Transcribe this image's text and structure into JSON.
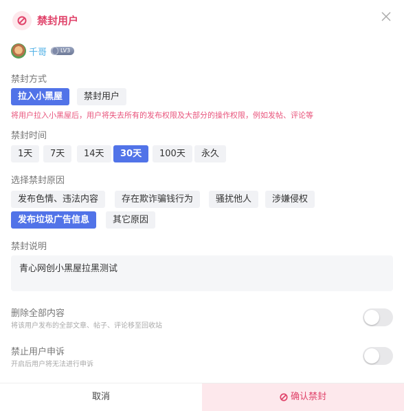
{
  "header": {
    "title": "禁封用户",
    "ban_icon": "ban-icon",
    "close_icon": "close-icon"
  },
  "user": {
    "name": "千哥",
    "level_badge": "LV3"
  },
  "ban_method": {
    "label": "禁封方式",
    "options": [
      "拉入小黑屋",
      "禁封用户"
    ],
    "selected": "拉入小黑屋",
    "hint": "将用户拉入小黑屋后，用户将失去所有的发布权限及大部分的操作权限，例如发帖、评论等"
  },
  "ban_duration": {
    "label": "禁封时间",
    "options": [
      "1天",
      "7天",
      "14天",
      "30天",
      "100天",
      "永久"
    ],
    "selected": "30天"
  },
  "ban_reason": {
    "label": "选择禁封原因",
    "options": [
      "发布色情、违法内容",
      "存在欺诈骗钱行为",
      "骚扰他人",
      "涉嫌侵权",
      "发布垃圾广告信息",
      "其它原因"
    ],
    "selected": "发布垃圾广告信息"
  },
  "ban_note": {
    "label": "禁封说明",
    "value": "青心网创小黑屋拉黑测试"
  },
  "options": {
    "delete_all": {
      "title": "删除全部内容",
      "desc": "将该用户发布的全部文章、帖子、评论移至回收站",
      "enabled": false
    },
    "forbid_appeal": {
      "title": "禁止用户申诉",
      "desc": "开启后用户将无法进行申诉",
      "enabled": false
    }
  },
  "footer": {
    "cancel_label": "取消",
    "confirm_label": "确认禁封"
  },
  "colors": {
    "accent": "#5173e8",
    "danger": "#e0436a",
    "danger_bg": "#fde8ec"
  }
}
